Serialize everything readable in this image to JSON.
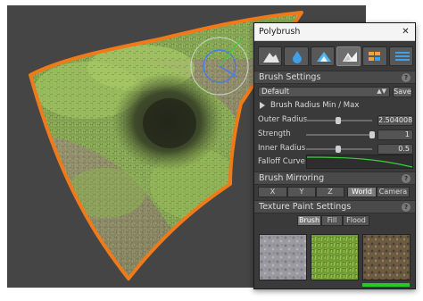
{
  "panel": {
    "title": "Polybrush",
    "close_glyph": "✕",
    "tools": [
      {
        "icon": "mountain-sculpt-icon",
        "active": false
      },
      {
        "icon": "smooth-drop-icon",
        "active": false
      },
      {
        "icon": "paint-brush-icon",
        "active": false
      },
      {
        "icon": "texture-paint-icon",
        "active": true
      },
      {
        "icon": "prefab-scatter-icon",
        "active": false
      },
      {
        "icon": "settings-list-icon",
        "active": false
      }
    ],
    "brush_settings": {
      "header": "Brush Settings",
      "help": "?",
      "preset": "Default",
      "save_label": "Save",
      "radius_foldout": "Brush Radius Min / Max",
      "outer_radius_label": "Outer Radius",
      "outer_radius_value": "2.504008",
      "outer_radius_fraction": 0.48,
      "strength_label": "Strength",
      "strength_value": "1",
      "strength_fraction": 1.0,
      "inner_radius_label": "Inner Radius",
      "inner_radius_value": "0.5",
      "inner_radius_fraction": 0.48,
      "falloff_label": "Falloff Curve"
    },
    "mirroring": {
      "header": "Brush Mirroring",
      "help": "?",
      "axes": [
        "X",
        "Y",
        "Z"
      ],
      "spaces": [
        "World",
        "Camera"
      ],
      "active_space": "World"
    },
    "texture_paint": {
      "header": "Texture Paint Settings",
      "help": "?",
      "modes": [
        "Brush",
        "Fill",
        "Flood"
      ],
      "active_mode": "Brush",
      "textures": [
        "stone-texture",
        "grass-texture",
        "dirt-texture"
      ],
      "selected_texture": 2,
      "selected_texture_strength": 1.0
    }
  },
  "colors": {
    "accent_orange": "#f07a1a",
    "selection_blue": "#2a6fd6",
    "green_bar": "#22cc22",
    "falloff_curve": "#3ccc3c"
  }
}
